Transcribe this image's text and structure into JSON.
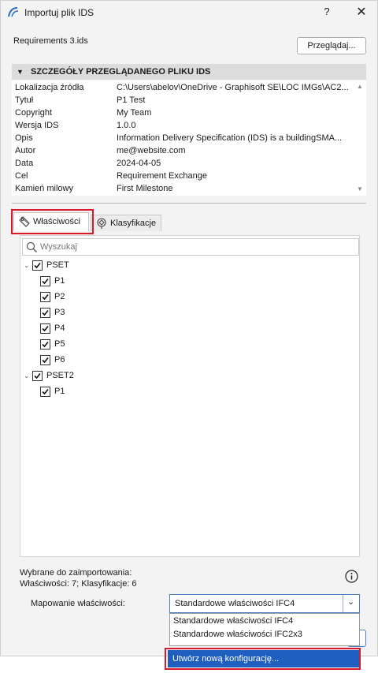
{
  "window": {
    "title": "Importuj plik IDS",
    "help": "?",
    "close": "✕"
  },
  "file": {
    "name": "Requirements 3.ids",
    "browse_label": "Przeglądaj..."
  },
  "details": {
    "header": "SZCZEGÓŁY PRZEGLĄDANEGO PLIKU IDS",
    "rows": [
      {
        "key": "Lokalizacja źródła",
        "value": "C:\\Users\\abelov\\OneDrive - Graphisoft SE\\LOC IMGs\\AC2..."
      },
      {
        "key": "Tytuł",
        "value": "P1 Test"
      },
      {
        "key": "Copyright",
        "value": "My Team"
      },
      {
        "key": "Wersja IDS",
        "value": "1.0.0"
      },
      {
        "key": "Opis",
        "value": "Information Delivery Specification (IDS) is a buildingSMA..."
      },
      {
        "key": "Autor",
        "value": "me@website.com"
      },
      {
        "key": "Data",
        "value": "2024-04-05"
      },
      {
        "key": "Cel",
        "value": "Requirement Exchange"
      },
      {
        "key": "Kamień milowy",
        "value": "First Milestone"
      }
    ]
  },
  "tabs": [
    {
      "label": "Właściwości",
      "active": true
    },
    {
      "label": "Klasyfikacje",
      "active": false
    }
  ],
  "search": {
    "placeholder": "Wyszukaj"
  },
  "tree": {
    "groups": [
      {
        "label": "PSET",
        "checked": true,
        "expanded": true,
        "children": [
          "P1",
          "P2",
          "P3",
          "P4",
          "P5",
          "P6"
        ]
      },
      {
        "label": "PSET2",
        "checked": true,
        "expanded": true,
        "children": [
          "P1"
        ]
      }
    ]
  },
  "summary": {
    "line1": "Wybrane do zaimportowania:",
    "line2": "Właściwości: 7; Klasyfikacje: 6"
  },
  "mapping": {
    "label": "Mapowanie właściwości:",
    "selected": "Standardowe właściwości IFC4",
    "options": [
      "Standardowe właściwości IFC4",
      "Standardowe właściwości IFC2x3"
    ],
    "new_config": "Utwórz nową konfigurację..."
  },
  "colors": {
    "highlight": "#d9182b",
    "selection": "#1f5fbf",
    "accent_border": "#4a7fc1"
  }
}
